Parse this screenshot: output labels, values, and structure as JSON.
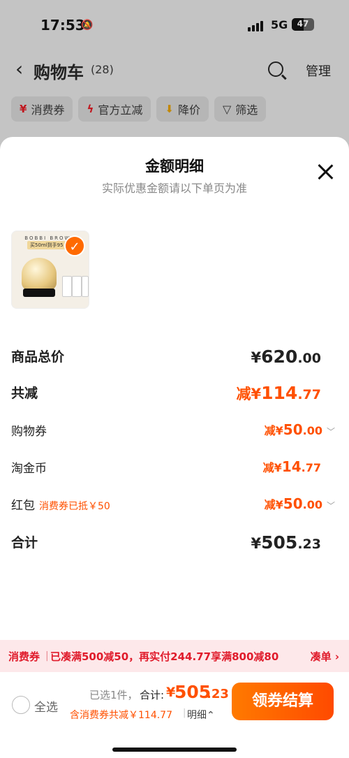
{
  "status_bar": {
    "time": "17:53",
    "network": "5G",
    "battery": "47"
  },
  "header": {
    "title": "购物车",
    "count": "(28)",
    "manage": "管理"
  },
  "filter_chips": [
    {
      "label": "消费券",
      "icon": "coupon-icon"
    },
    {
      "label": "官方立减",
      "icon": "lightning-icon"
    },
    {
      "label": "降价",
      "icon": "price-down-icon"
    },
    {
      "label": "筛选",
      "icon": "filter-icon"
    }
  ],
  "sheet": {
    "title": "金额明细",
    "subtitle": "实际优惠金额请以下单页为准",
    "product": {
      "brand": "BOBBI BROWN",
      "promo": "买50ml到手95"
    },
    "rows": {
      "subtotal": {
        "label": "商品总价",
        "yen": "¥",
        "int": "620",
        "dec": ".00"
      },
      "total_reduce": {
        "label": "共减",
        "prefix": "减¥",
        "int": "114",
        "dec": ".77"
      },
      "shop_coupon": {
        "label": "购物券",
        "prefix": "减¥",
        "int": "50",
        "dec": ".00"
      },
      "taojinbi": {
        "label": "淘金币",
        "prefix": "减¥",
        "int": "14",
        "dec": ".77"
      },
      "red_packet": {
        "label": "红包",
        "tag": "消费券已抵￥50",
        "prefix": "减¥",
        "int": "50",
        "dec": ".00"
      },
      "total": {
        "label": "合计",
        "yen": "¥",
        "int": "505",
        "dec": ".23"
      }
    }
  },
  "banner": {
    "tag": "消费券",
    "text": "已凑满500减50，再实付244.77享满800减80",
    "action": "凑单 ›"
  },
  "bottom_bar": {
    "select_all": "全选",
    "picked": "已选1件，",
    "total_label": "合计:",
    "yen": "¥",
    "total_int": "505",
    "total_dec": ".23",
    "reduce": "含消费券共减￥114.77",
    "detail": "明细⌃",
    "cta": "领券结算"
  },
  "colors": {
    "accent": "#ff5000",
    "coupon_red": "#e01b2b",
    "banner_bg": "#fde8ea"
  }
}
